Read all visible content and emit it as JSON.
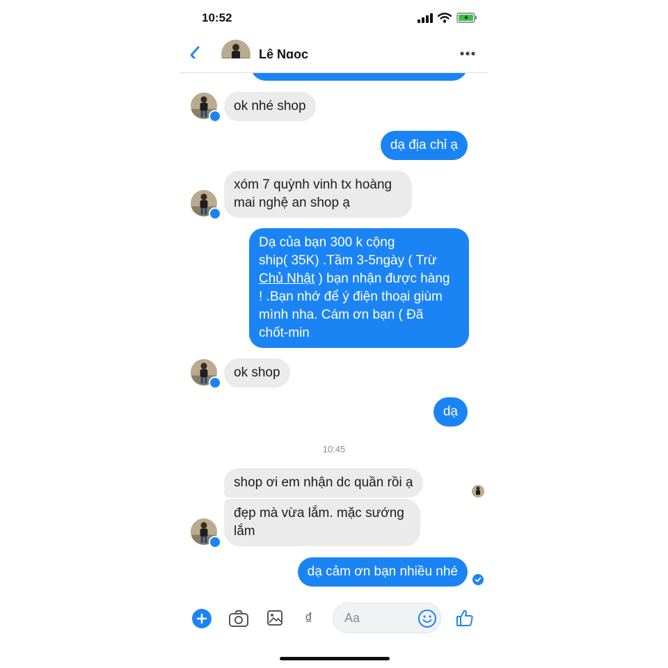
{
  "status_bar": {
    "time": "10:52"
  },
  "header": {
    "contact_name": "Lê Ngọc"
  },
  "messages": [
    {
      "side": "in",
      "text": "ok nhé shop"
    },
    {
      "side": "out",
      "text": "dạ địa chỉ ạ"
    },
    {
      "side": "in",
      "lines": [
        "xóm 7 quỳnh vinh tx hoàng",
        "mai nghệ an shop ạ"
      ]
    },
    {
      "side": "out",
      "lines": [
        "Dạ của bạn   300 k  cộng",
        "ship( 35K) .Tầm 3-5ngày ( Trừ"
      ],
      "line3_link": "Chủ Nhật",
      "line3_rest": " ) bạn nhận được hàng",
      "lines_tail": [
        "!  .Bạn nhớ để ý điện thoại giùm",
        "mình nha. Cám ơn bạn ( Đã",
        "chốt-min"
      ]
    },
    {
      "side": "in",
      "text": "ok shop"
    },
    {
      "side": "out",
      "text": "dạ"
    },
    {
      "side": "in",
      "text": "shop ơi em nhận dc quần rồi ạ"
    },
    {
      "side": "in",
      "lines": [
        "đẹp mà vừa lắm. mặc sướng",
        "lắm"
      ]
    },
    {
      "side": "out",
      "text": "dạ cảm ơn bạn nhiều nhé"
    }
  ],
  "timestamp_divider": "10:45",
  "composer": {
    "placeholder": "Aa",
    "currency_symbol": "₫",
    "icons": [
      "plus-icon",
      "camera-icon",
      "image-icon",
      "dong-icon",
      "emoji-icon",
      "like-icon"
    ]
  },
  "colors": {
    "accent": "#1b84f5",
    "incoming_bubble": "#ebebeb"
  }
}
